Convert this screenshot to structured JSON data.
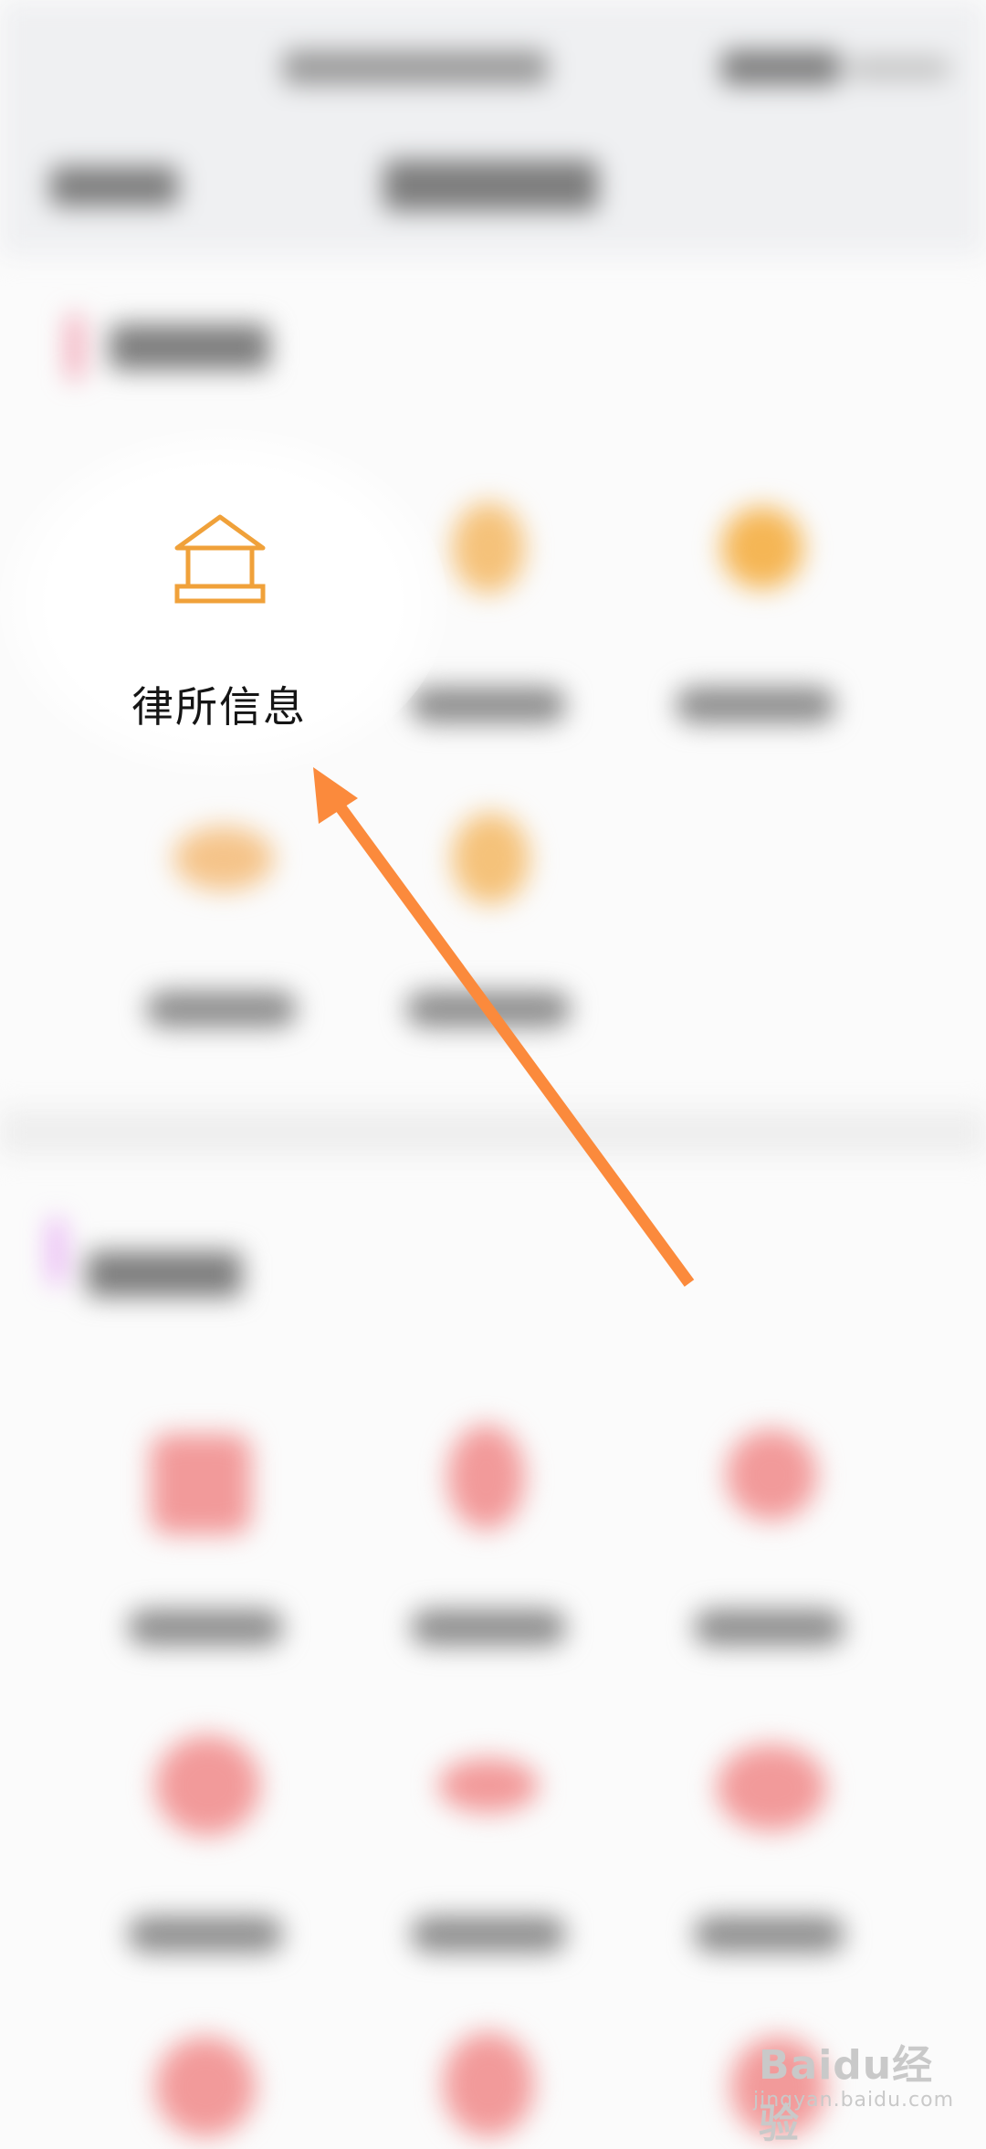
{
  "featured_item": {
    "label": "律所信息",
    "icon": "bank-building-icon",
    "icon_color": "#f0a13a"
  },
  "annotation": {
    "arrow_color": "#fb8a3c"
  },
  "watermark": {
    "brand": "Baidu经验",
    "url": "jingyan.baidu.com"
  }
}
